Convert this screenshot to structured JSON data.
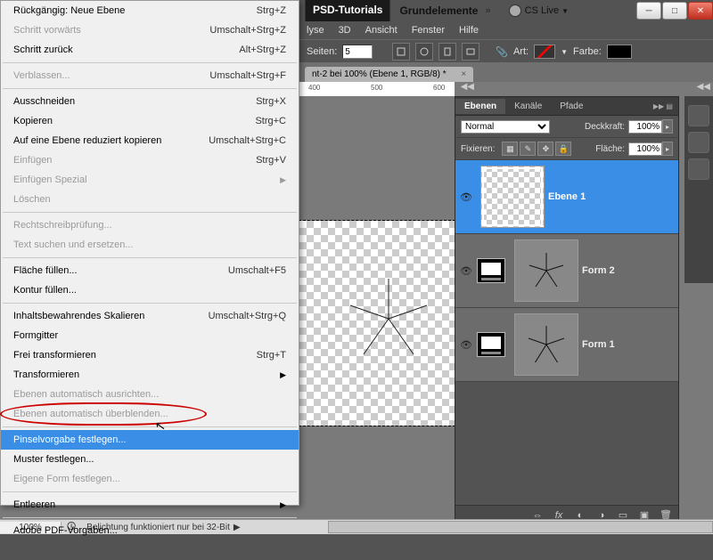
{
  "top": {
    "psd_tutorials": "PSD-Tutorials",
    "grundelemente": "Grundelemente",
    "cslive": "CS Live"
  },
  "submenu": {
    "analyse": "lyse",
    "dd": "3D",
    "ansicht": "Ansicht",
    "fenster": "Fenster",
    "hilfe": "Hilfe"
  },
  "optbar": {
    "seiten_label": "Seiten:",
    "seiten_val": "5",
    "art_label": "Art:",
    "farbe_label": "Farbe:"
  },
  "doc": {
    "tab": "nt-2 bei 100% (Ebene 1, RGB/8) *"
  },
  "ruler": {
    "a": "400",
    "b": "500",
    "c": "600"
  },
  "panel": {
    "tabs": {
      "ebenen": "Ebenen",
      "kanale": "Kanäle",
      "pfade": "Pfade"
    },
    "mode": "Normal",
    "deck_label": "Deckkraft:",
    "deck_val": "100%",
    "fix_label": "Fixieren:",
    "flache_label": "Fläche:",
    "flache_val": "100%",
    "layer1": "Ebene 1",
    "layer2": "Form 2",
    "layer3": "Form 1"
  },
  "status": {
    "zoom": "100%",
    "msg": "Belichtung funktioniert nur bei 32-Bit"
  },
  "menu": {
    "undo": "Rückgängig: Neue Ebene",
    "undo_k": "Strg+Z",
    "fwd": "Schritt vorwärts",
    "fwd_k": "Umschalt+Strg+Z",
    "back": "Schritt zurück",
    "back_k": "Alt+Strg+Z",
    "verblassen": "Verblassen...",
    "verblassen_k": "Umschalt+Strg+F",
    "cut": "Ausschneiden",
    "cut_k": "Strg+X",
    "copy": "Kopieren",
    "copy_k": "Strg+C",
    "copyflat": "Auf eine Ebene reduziert kopieren",
    "copyflat_k": "Umschalt+Strg+C",
    "paste": "Einfügen",
    "paste_k": "Strg+V",
    "paste_sp": "Einfügen Spezial",
    "loeschen": "Löschen",
    "spell": "Rechtschreibprüfung...",
    "findrep": "Text suchen und ersetzen...",
    "fill": "Fläche füllen...",
    "fill_k": "Umschalt+F5",
    "stroke": "Kontur füllen...",
    "cascale": "Inhaltsbewahrendes Skalieren",
    "cascale_k": "Umschalt+Strg+Q",
    "formgitter": "Formgitter",
    "freetrans": "Frei transformieren",
    "freetrans_k": "Strg+T",
    "transform": "Transformieren",
    "autoalign": "Ebenen automatisch ausrichten...",
    "autoblend": "Ebenen automatisch überblenden...",
    "pinsel": "Pinselvorgabe festlegen...",
    "muster": "Muster festlegen...",
    "eigform": "Eigene Form festlegen...",
    "entleeren": "Entleeren",
    "pdf": "Adobe PDF-Vorgaben..."
  }
}
